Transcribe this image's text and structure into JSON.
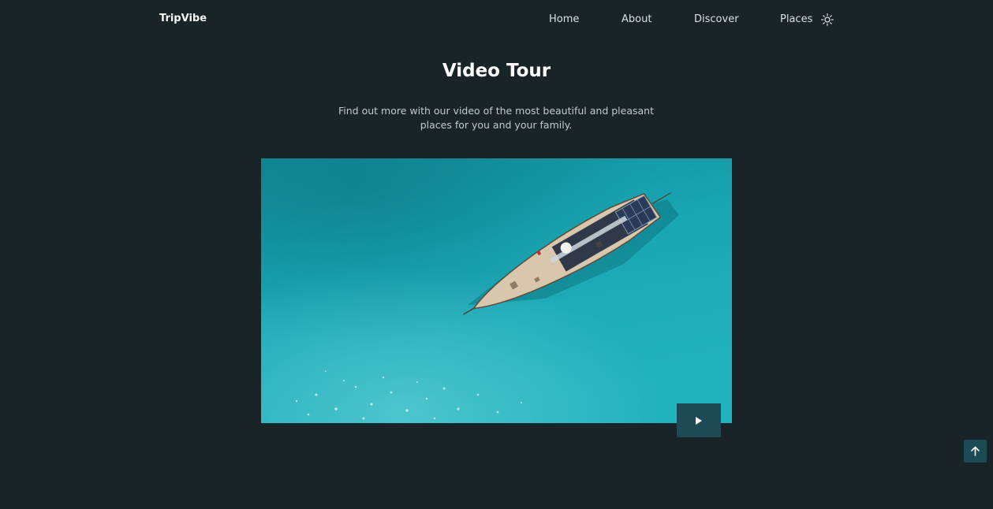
{
  "header": {
    "logo": "TripVibe",
    "nav": [
      {
        "label": "Home"
      },
      {
        "label": "About"
      },
      {
        "label": "Discover"
      },
      {
        "label": "Places"
      }
    ],
    "theme_toggle_icon": "sun-icon"
  },
  "section": {
    "title": "Video Tour",
    "description": "Find out more with our video of the most beautiful and pleasant places for you and your family."
  },
  "video": {
    "scene": "aerial-sailboat-on-turquoise-sea",
    "play_icon": "play-icon"
  },
  "scroll_top": {
    "icon": "arrow-up-icon"
  },
  "colors": {
    "background": "#182428",
    "accent": "#1c4a55",
    "sea": "#1aa6b3"
  }
}
